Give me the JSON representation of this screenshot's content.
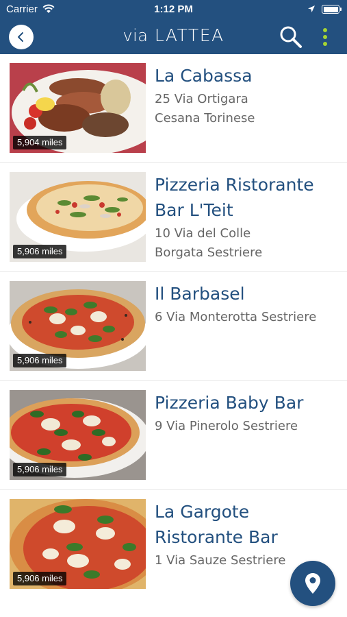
{
  "status_bar": {
    "carrier": "Carrier",
    "time": "1:12 PM"
  },
  "header": {
    "logo_via": "via",
    "logo_name": "LATTEA"
  },
  "colors": {
    "header_bg": "#23507f",
    "accent": "#a4d433",
    "title": "#23507f"
  },
  "icons": {
    "back": "chevron-left-icon",
    "search": "search-icon",
    "menu": "more-vertical-icon",
    "map": "map-pin-icon"
  },
  "restaurants": [
    {
      "name": "La Cabassa",
      "address_1": "25 Via Ortigara",
      "address_2": "Cesana Torinese",
      "distance": "5,904 miles"
    },
    {
      "name": "Pizzeria Ristorante Bar L'Teit",
      "address_1": "10 Via del Colle",
      "address_2": "Borgata Sestriere",
      "distance": "5,906 miles"
    },
    {
      "name": "Il Barbasel",
      "address_1": "6 Via Monterotta Sestriere",
      "address_2": "",
      "distance": "5,906 miles"
    },
    {
      "name": "Pizzeria Baby Bar",
      "address_1": "9 Via Pinerolo Sestriere",
      "address_2": "",
      "distance": "5,906 miles"
    },
    {
      "name": "La Gargote Ristorante Bar",
      "address_1": "1 Via Sauze Sestriere",
      "address_2": "",
      "distance": "5,906 miles"
    }
  ]
}
